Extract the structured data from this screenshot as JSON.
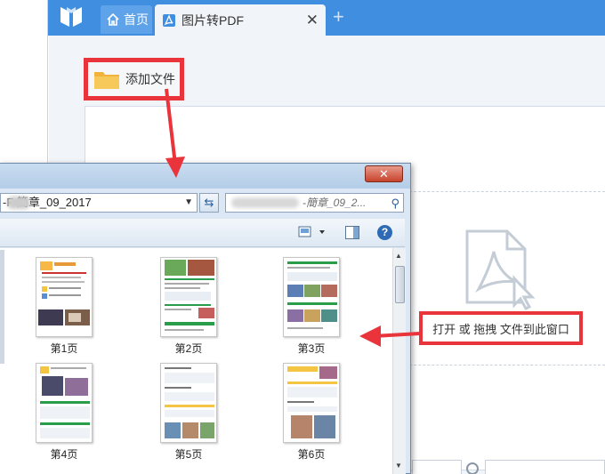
{
  "app": {
    "tabs": [
      {
        "label": "首页",
        "icon": "home-icon"
      },
      {
        "label": "图片转PDF",
        "icon": "pdf-icon"
      }
    ],
    "add_tab_symbol": "+",
    "close_symbol": "✕",
    "add_file_label": "添加文件",
    "drop_hint": "打开 或 拖拽 文件到此窗口",
    "colors": {
      "titlebar": "#3f8ee0",
      "highlight": "#e8343a",
      "content_bg": "#f1f4f8"
    }
  },
  "dialog": {
    "close_symbol": "✕",
    "address": "-F   簡章_09_2017",
    "search_text": "-簡章_09_2...",
    "files": [
      {
        "label": "第1页"
      },
      {
        "label": "第2页"
      },
      {
        "label": "第3页"
      },
      {
        "label": "第4页"
      },
      {
        "label": "第5页"
      },
      {
        "label": "第6页"
      }
    ]
  }
}
